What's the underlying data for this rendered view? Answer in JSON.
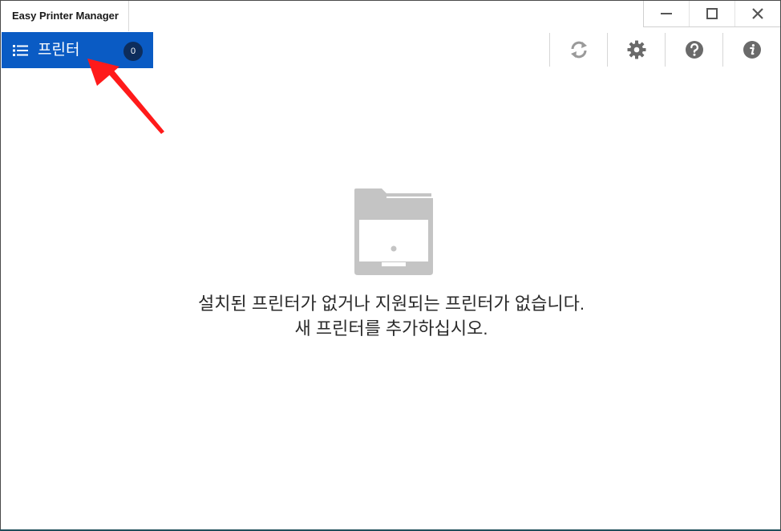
{
  "window": {
    "title": "Easy Printer Manager",
    "controls": {
      "minimize_icon": "minimize-icon",
      "maximize_icon": "maximize-icon",
      "close_icon": "close-icon"
    }
  },
  "sidebar_tab": {
    "label": "프린터",
    "count": "0",
    "icon": "list-icon",
    "color": "#0a5bc4"
  },
  "toolbar": {
    "items": [
      {
        "icon": "refresh-icon"
      },
      {
        "icon": "gear-icon"
      },
      {
        "icon": "help-icon"
      },
      {
        "icon": "info-icon"
      }
    ]
  },
  "empty_state": {
    "icon": "printer-icon",
    "line1": "설치된 프린터가 없거나 지원되는 프린터가 없습니다.",
    "line2": "새 프린터를 추가하십시오."
  },
  "annotation": {
    "icon": "red-arrow-icon",
    "color": "#ff1a1a"
  }
}
